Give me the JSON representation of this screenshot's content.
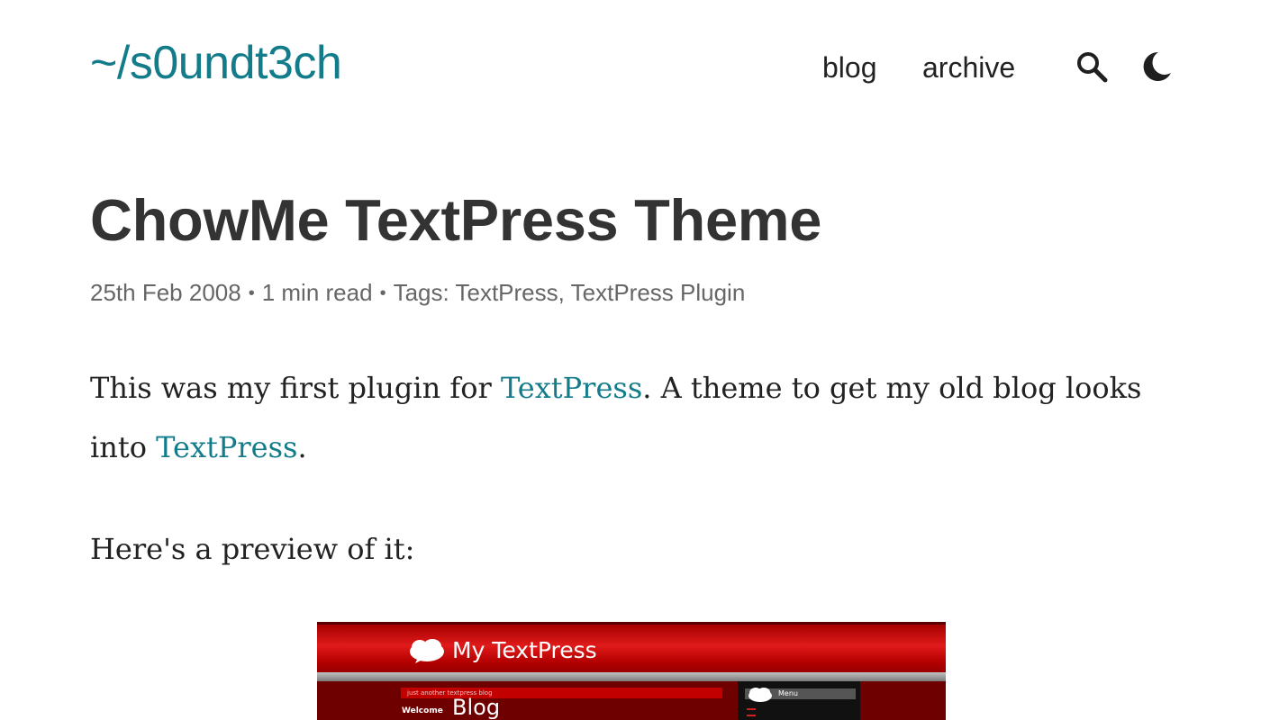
{
  "header": {
    "site_title": "~/s0undt3ch",
    "nav": [
      {
        "label": "blog"
      },
      {
        "label": "archive"
      }
    ],
    "search_icon": "search-icon",
    "theme_icon": "moon-icon"
  },
  "post": {
    "title": "ChowMe TextPress Theme",
    "meta": {
      "date": "25th Feb 2008",
      "separator": "•",
      "read_time": "1 min read",
      "tags_label": "Tags:",
      "tags": [
        "TextPress",
        "TextPress Plugin"
      ],
      "tags_delimiter": ","
    },
    "body": {
      "p1_before": "This was my first plugin for ",
      "p1_link1": "TextPress",
      "p1_middle": ". A theme to get my old blog looks into ",
      "p1_link2": "TextPress",
      "p1_after": ".",
      "p2": "Here's a preview of it:"
    },
    "preview": {
      "site_name": "My TextPress",
      "tagline": "just another textpress blog",
      "welcome": "Welcome",
      "blog": "Blog",
      "menu": "Menu"
    }
  },
  "colors": {
    "accent": "#137c8b",
    "text": "#222222",
    "meta": "#666666"
  }
}
